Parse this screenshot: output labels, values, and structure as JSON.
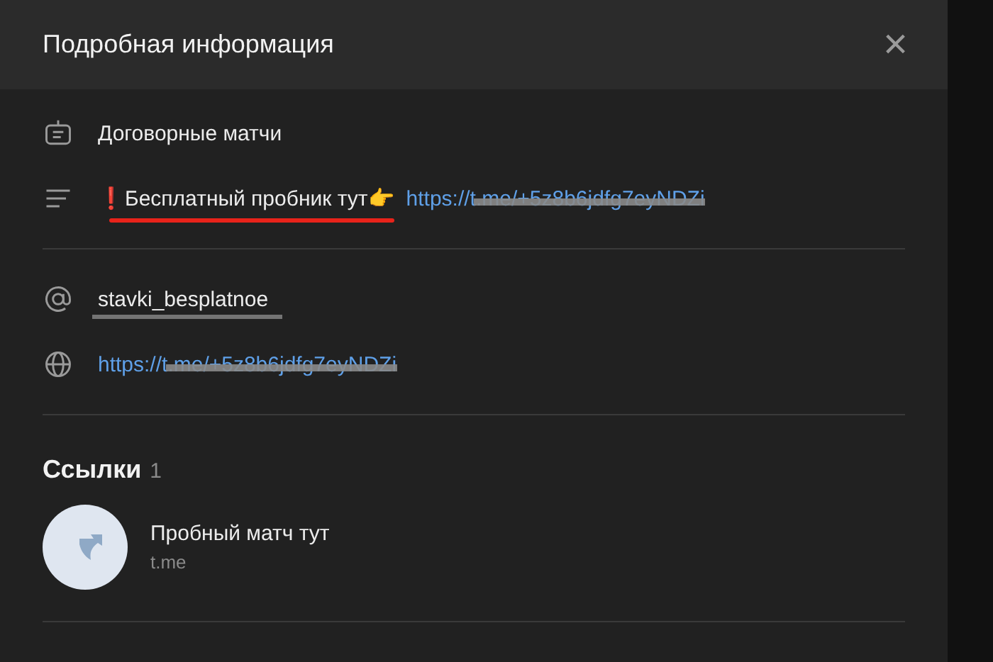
{
  "window": {
    "title": "Подробная информация",
    "close": "×"
  },
  "info": {
    "name": "Договорные матчи",
    "description": "❗Бесплатный пробник тут👉",
    "description_link": "https://t.me/+5z8b6jdfg7eyNDZi",
    "username": "stavki_besplatnoe",
    "link": "https://t.me/+5z8b6jdfg7eyNDZi"
  },
  "links_section": {
    "title": "Ссылки",
    "count": "1",
    "items": [
      {
        "title": "Пробный матч тут",
        "domain": "t.me"
      }
    ]
  }
}
